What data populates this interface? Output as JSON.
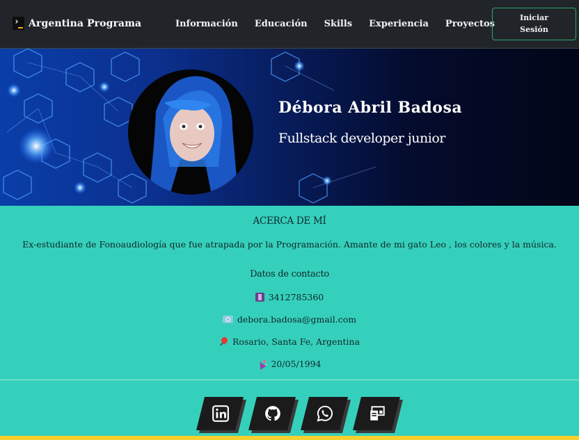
{
  "navbar": {
    "brand": "Argentina Programa",
    "links": [
      "Información",
      "Educación",
      "Skills",
      "Experiencia",
      "Proyectos"
    ],
    "login_label": "Iniciar Sesión"
  },
  "hero": {
    "name": "Débora Abril Badosa",
    "role": "Fullstack developer junior"
  },
  "about": {
    "title": "ACERCA DE MÍ",
    "description": "Ex-estudiante de Fonoaudiología que fue atrapada por la Programación. Amante de mi gato Leo , los colores y la música.",
    "contact_title": "Datos de contacto",
    "phone": "3412785360",
    "email": "debora.badosa@gmail.com",
    "location": "Rosario, Santa Fe, Argentina",
    "birthday": "20/05/1994"
  },
  "social": {
    "icons": [
      "linkedin-icon",
      "github-icon",
      "whatsapp-icon",
      "portfolio-icon"
    ]
  },
  "colors": {
    "navbar_bg": "#212529",
    "accent_green": "#2ea76d",
    "teal_bg": "#35d0bb",
    "bottom_bar": "#f6d02f"
  }
}
